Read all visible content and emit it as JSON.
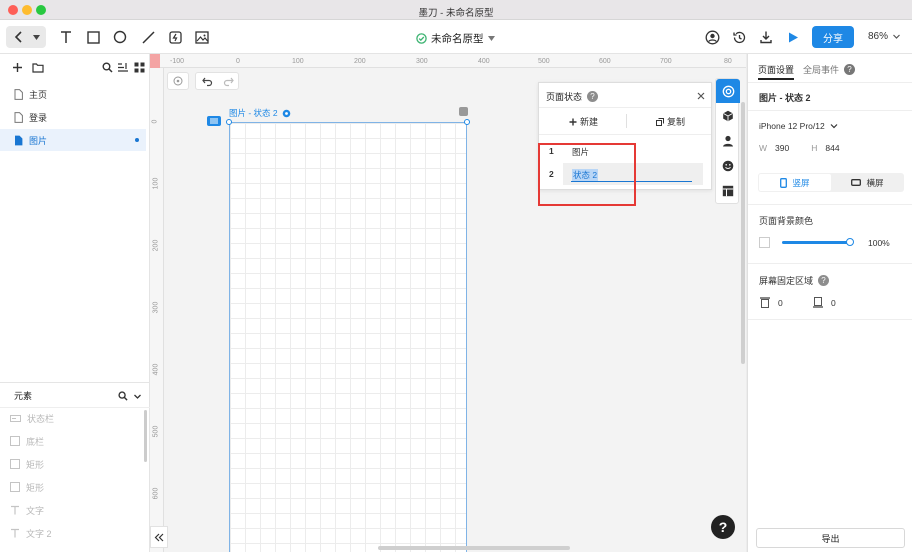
{
  "window": {
    "title": "墨刀 - 未命名原型"
  },
  "toolbar": {
    "project_name": "未命名原型",
    "share_label": "分享",
    "zoom": "86%"
  },
  "left_panel": {
    "pages": [
      {
        "label": "主页",
        "selected": false
      },
      {
        "label": "登录",
        "selected": false
      },
      {
        "label": "图片",
        "selected": true
      }
    ],
    "elements_title": "元素",
    "elements": [
      {
        "icon": "statusbar-icon",
        "label": "状态栏"
      },
      {
        "icon": "rect-icon",
        "label": "底栏"
      },
      {
        "icon": "rect-icon",
        "label": "矩形"
      },
      {
        "icon": "rect-icon",
        "label": "矩形"
      },
      {
        "icon": "text-icon",
        "label": "文字"
      },
      {
        "icon": "text-icon",
        "label": "文字 2"
      }
    ]
  },
  "canvas": {
    "ruler_h": [
      "-100",
      "0",
      "100",
      "200",
      "300",
      "400",
      "500",
      "600",
      "700",
      "80"
    ],
    "ruler_v": [
      "0",
      "100",
      "200",
      "300",
      "400",
      "500",
      "600"
    ],
    "artboard_label": "图片 - 状态 2"
  },
  "state_panel": {
    "title": "页面状态",
    "new_label": "新建",
    "copy_label": "复制",
    "states": [
      {
        "index": "1",
        "name": "图片"
      },
      {
        "index": "2",
        "name": "状态 2"
      }
    ]
  },
  "right_panel": {
    "tab_page_settings": "页面设置",
    "tab_global_events": "全局事件",
    "page_name": "图片 - 状态 2",
    "device": "iPhone 12 Pro/12",
    "width_label": "W",
    "width_value": "390",
    "height_label": "H",
    "height_value": "844",
    "portrait_label": "竖屏",
    "landscape_label": "横屏",
    "bg_color_title": "页面背景颜色",
    "opacity": "100%",
    "fixed_area_title": "屏幕固定区域",
    "fixed_top": "0",
    "fixed_bottom": "0",
    "export_label": "导出"
  },
  "colors": {
    "accent": "#1e88e5",
    "highlight": "#e53935"
  }
}
